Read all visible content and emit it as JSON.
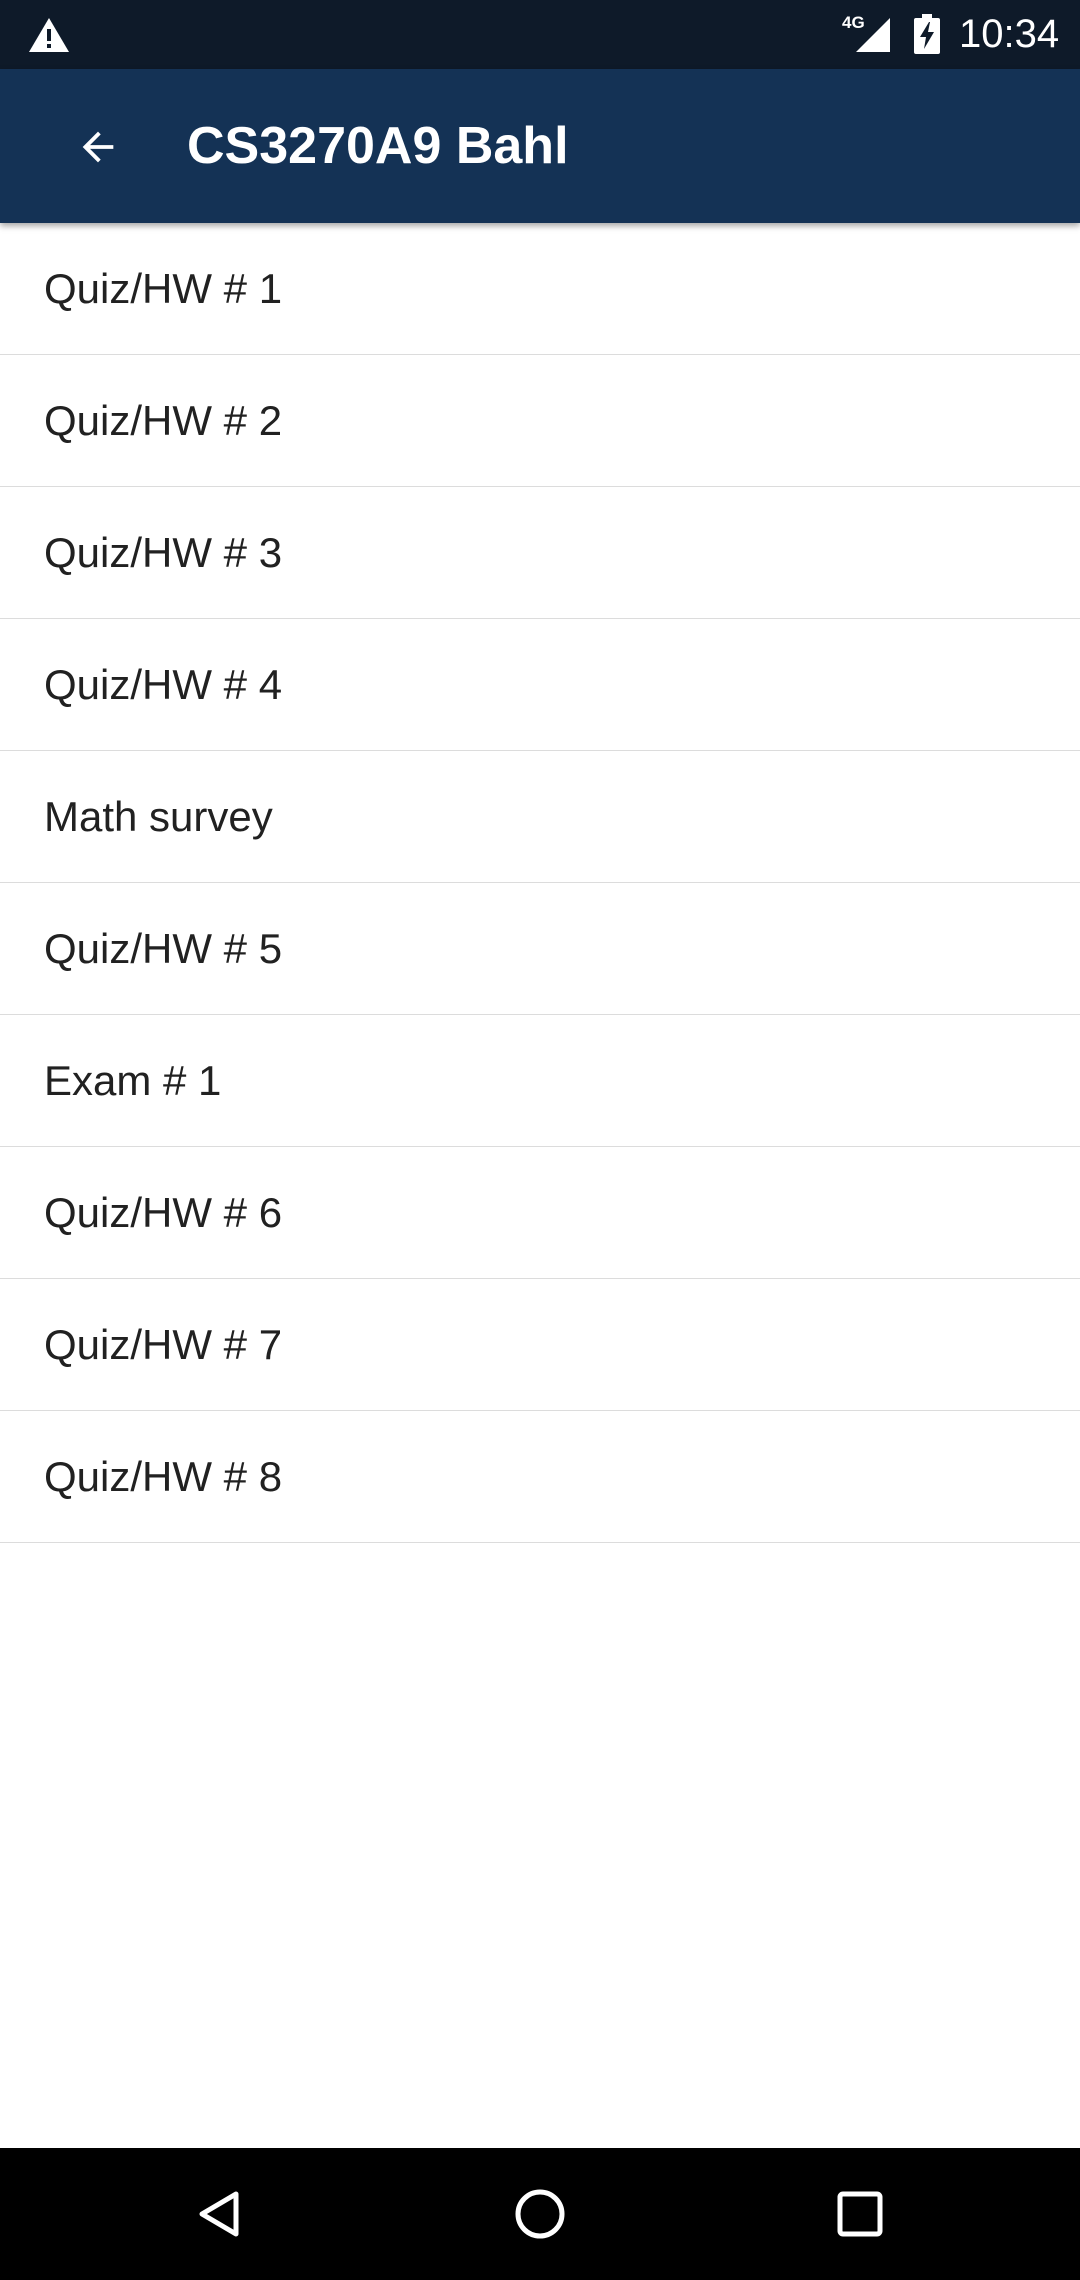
{
  "status_bar": {
    "network": "4G",
    "time": "10:34",
    "icons": [
      "warning-icon",
      "signal-icon",
      "battery-charging-icon"
    ]
  },
  "app_bar": {
    "title": "CS3270A9 Bahl",
    "back_icon": "arrow-back-icon"
  },
  "list": {
    "items": [
      {
        "label": "Quiz/HW # 1"
      },
      {
        "label": "Quiz/HW # 2"
      },
      {
        "label": "Quiz/HW # 3"
      },
      {
        "label": "Quiz/HW # 4"
      },
      {
        "label": "Math survey"
      },
      {
        "label": "Quiz/HW # 5"
      },
      {
        "label": "Exam # 1"
      },
      {
        "label": "Quiz/HW # 6"
      },
      {
        "label": "Quiz/HW # 7"
      },
      {
        "label": "Quiz/HW # 8"
      }
    ]
  },
  "nav_bar": {
    "icons": [
      "nav-back-icon",
      "nav-home-icon",
      "nav-recents-icon"
    ]
  },
  "colors": {
    "status_bar": "#0e1a29",
    "app_bar": "#143255",
    "nav_bar": "#000000",
    "list_text": "#212121",
    "divider": "#dcdcdc"
  }
}
